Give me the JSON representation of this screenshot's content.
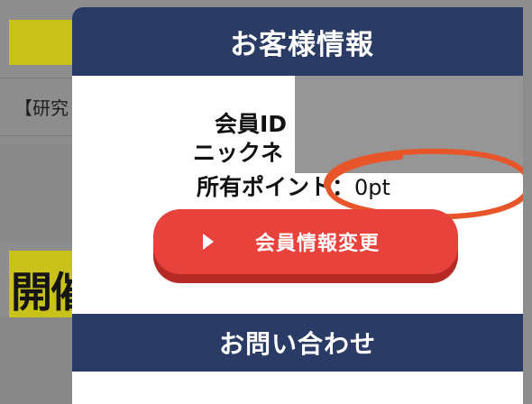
{
  "background": {
    "row_text": "【研究",
    "headline_fragment": "開催"
  },
  "modal": {
    "title": "お客様情報",
    "fields": {
      "member_id_label": "会員ID",
      "nickname_label": "ニックネ",
      "points_label": "所有ポイント：",
      "points_value": "0pt"
    },
    "change_button_label": "会員情報変更",
    "contact_title": "お問い合わせ"
  },
  "colors": {
    "header_navy": "#2a3c66",
    "button_red": "#e8423c",
    "annotation_orange": "#e8552a",
    "bg_yellow": "#c9c21b"
  }
}
